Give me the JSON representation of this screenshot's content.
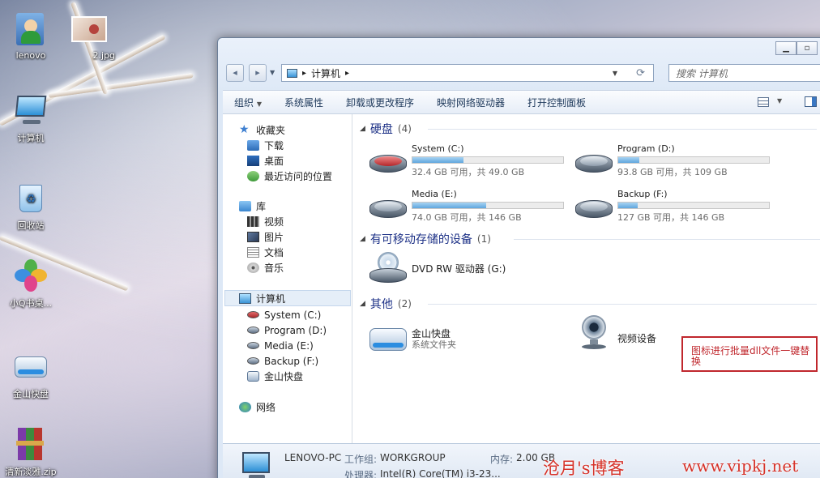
{
  "desktop": {
    "icons": [
      {
        "label": "lenovo",
        "icon": "user-folder-icon"
      },
      {
        "label": "2.jpg",
        "icon": "image-file-icon"
      },
      {
        "label": "计算机",
        "icon": "computer-icon"
      },
      {
        "label": "回收站",
        "icon": "recycle-bin-icon"
      },
      {
        "label": "小Q书桌...",
        "icon": "qq-desk-icon"
      },
      {
        "label": "金山快盘",
        "icon": "cloud-drive-icon"
      },
      {
        "label": "清新淡雅.zip",
        "icon": "rar-archive-icon"
      }
    ]
  },
  "window": {
    "address": {
      "arrow": "▸",
      "path": "计算机",
      "trail_arrow": "▸"
    },
    "search_placeholder": "搜索 计算机",
    "toolbar": [
      "组织",
      "系统属性",
      "卸载或更改程序",
      "映射网络驱动器",
      "打开控制面板"
    ],
    "nav": {
      "favorites": {
        "label": "收藏夹",
        "items": [
          "下载",
          "桌面",
          "最近访问的位置"
        ]
      },
      "libraries": {
        "label": "库",
        "items": [
          "视频",
          "图片",
          "文档",
          "音乐"
        ]
      },
      "computer": {
        "label": "计算机",
        "items": [
          "System (C:)",
          "Program (D:)",
          "Media (E:)",
          "Backup (F:)",
          "金山快盘"
        ]
      },
      "network": {
        "label": "网络"
      }
    },
    "groups": {
      "hdd": {
        "title": "硬盘",
        "count": "(4)"
      },
      "removable": {
        "title": "有可移动存储的设备",
        "count": "(1)"
      },
      "other": {
        "title": "其他",
        "count": "(2)"
      }
    },
    "drives": [
      {
        "name": "System (C:)",
        "info": "32.4 GB 可用，共 49.0 GB",
        "used_fraction": 0.34
      },
      {
        "name": "Program (D:)",
        "info": "93.8 GB 可用，共 109 GB",
        "used_fraction": 0.14
      },
      {
        "name": "Media (E:)",
        "info": "74.0 GB 可用，共 146 GB",
        "used_fraction": 0.49
      },
      {
        "name": "Backup (F:)",
        "info": "127 GB 可用，共 146 GB",
        "used_fraction": 0.13
      }
    ],
    "removable": {
      "name": "DVD RW 驱动器 (G:)"
    },
    "other": [
      {
        "name": "金山快盘",
        "sub": "系统文件夹"
      },
      {
        "name": "视频设备",
        "sub": ""
      }
    ],
    "details": {
      "pc_name": "LENOVO-PC",
      "workgroup_label": "工作组:",
      "workgroup": "WORKGROUP",
      "memory_label": "内存:",
      "memory": "2.00 GB",
      "cpu_label": "处理器:",
      "cpu": "Intel(R) Core(TM) i3-23..."
    },
    "controls": {
      "minimize": "▁",
      "maximize": "▫"
    }
  },
  "overlay": {
    "callout": "图标进行批量dll文件一键替换",
    "watermark_left": "沧月's博客",
    "watermark_right": "www.vipkj.net"
  }
}
